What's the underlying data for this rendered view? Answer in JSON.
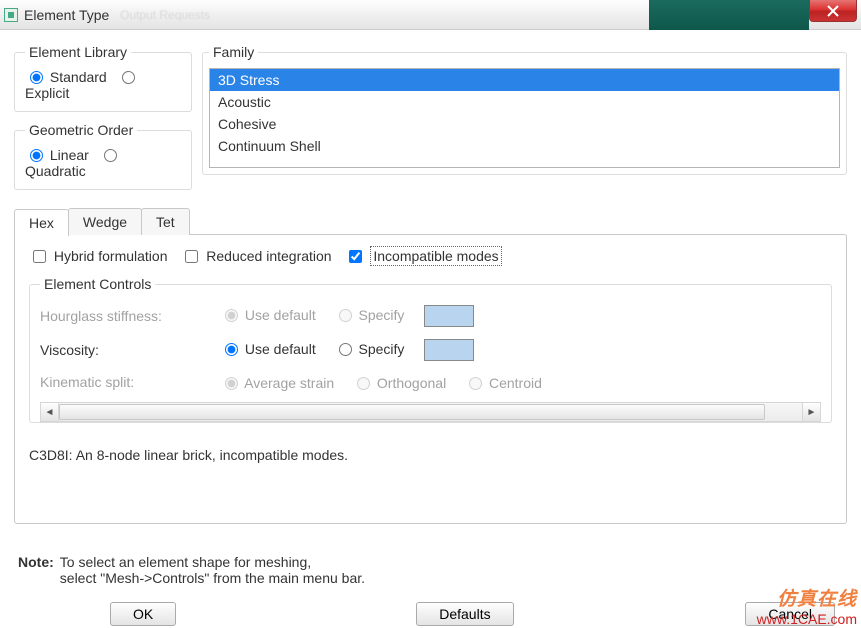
{
  "window": {
    "title": "Element Type"
  },
  "elementLibrary": {
    "legend": "Element Library",
    "options": {
      "standard": "Standard",
      "explicit": "Explicit"
    },
    "selected": "standard"
  },
  "geometricOrder": {
    "legend": "Geometric Order",
    "options": {
      "linear": "Linear",
      "quadratic": "Quadratic"
    },
    "selected": "linear"
  },
  "family": {
    "legend": "Family",
    "items": [
      "3D Stress",
      "Acoustic",
      "Cohesive",
      "Continuum Shell"
    ],
    "selectedIndex": 0
  },
  "tabs": {
    "items": [
      "Hex",
      "Wedge",
      "Tet"
    ],
    "activeIndex": 0
  },
  "options": {
    "hybrid": {
      "label": "Hybrid formulation",
      "checked": false
    },
    "reduced": {
      "label": "Reduced integration",
      "checked": false
    },
    "incompatible": {
      "label": "Incompatible modes",
      "checked": true
    }
  },
  "elementControls": {
    "legend": "Element Controls",
    "rows": {
      "hourglass": {
        "label": "Hourglass stiffness:",
        "useDefault": "Use default",
        "specify": "Specify",
        "enabled": false,
        "selected": "useDefault"
      },
      "viscosity": {
        "label": "Viscosity:",
        "useDefault": "Use default",
        "specify": "Specify",
        "enabled": true,
        "selected": "useDefault"
      },
      "kinematic": {
        "label": "Kinematic split:",
        "opts": {
          "avg": "Average strain",
          "orth": "Orthogonal",
          "cent": "Centroid"
        },
        "enabled": false,
        "selected": "avg"
      }
    }
  },
  "description": "C3D8I:  An 8-node linear brick, incompatible modes.",
  "note": {
    "label": "Note:",
    "line1": "To select an element shape for meshing,",
    "line2": "select \"Mesh->Controls\" from the main menu bar."
  },
  "buttons": {
    "ok": "OK",
    "defaults": "Defaults",
    "cancel": "Cancel"
  },
  "watermark": {
    "line1": "仿真在线",
    "line2": "www.1CAE.com"
  }
}
